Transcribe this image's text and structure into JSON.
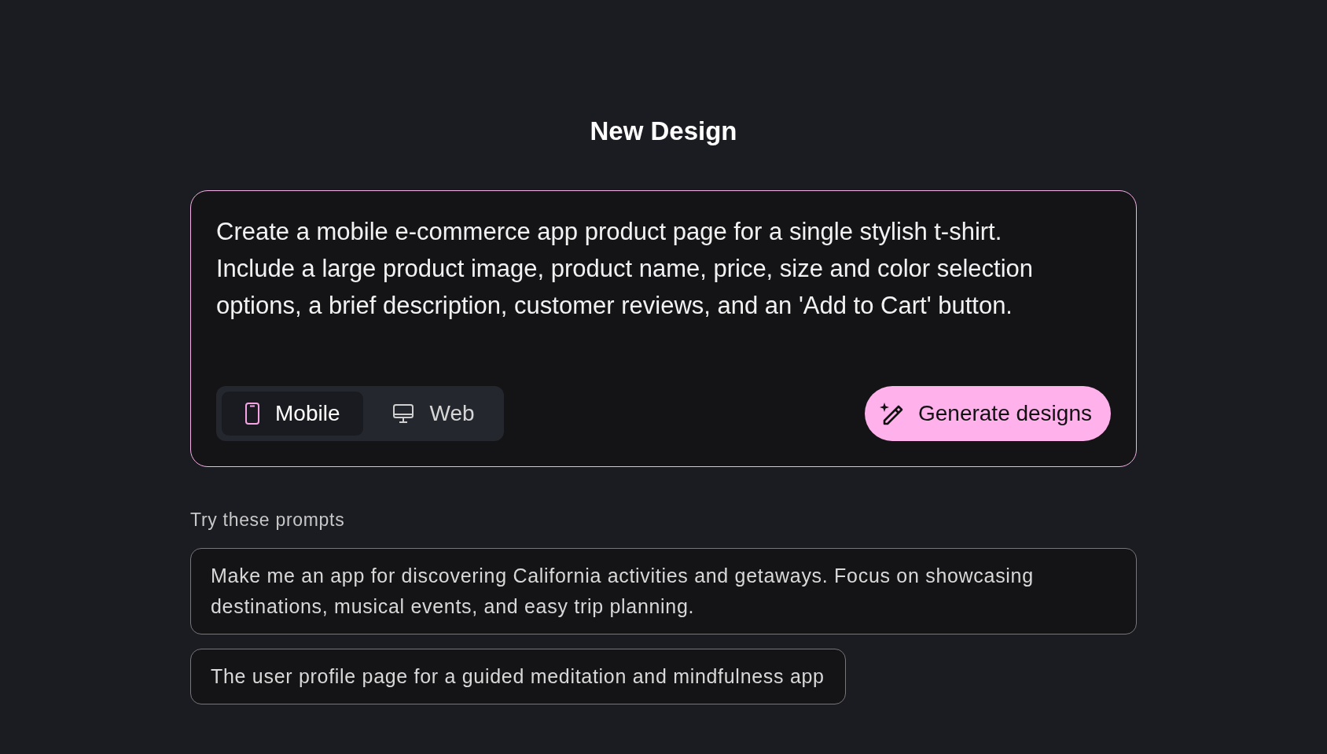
{
  "title": "New Design",
  "prompt": {
    "value": "Create a mobile e-commerce app product page for a single stylish t-shirt. Include a large product image, product name, price, size and color selection options, a brief description, customer reviews, and an 'Add to Cart' button."
  },
  "platforms": [
    {
      "label": "Mobile",
      "kind": "mobile",
      "selected": true
    },
    {
      "label": "Web",
      "kind": "web",
      "selected": false
    }
  ],
  "generate_button": {
    "label": "Generate designs"
  },
  "suggestions": {
    "heading": "Try these prompts",
    "items": [
      "Make me an app for discovering California activities and getaways. Focus on showcasing destinations, musical events, and easy trip planning.",
      "The user profile page for a guided meditation and mindfulness app"
    ]
  }
}
